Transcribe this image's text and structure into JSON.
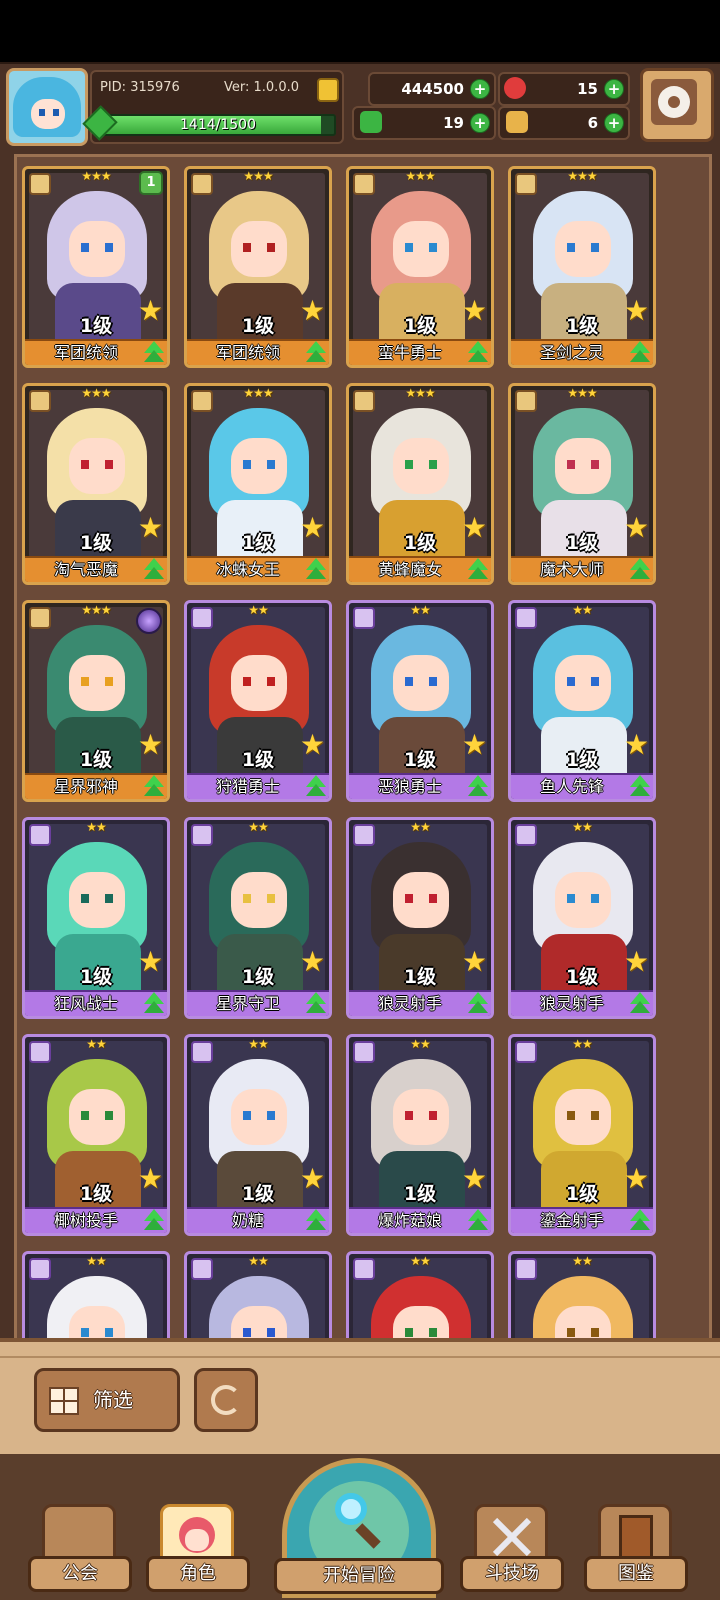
{
  "header": {
    "pid": "PID: 315976",
    "version": "Ver: 1.0.0.0",
    "exp_text": "1414/1500",
    "exp_progress": 0.943,
    "resources": [
      {
        "name": "gold",
        "value": "444500",
        "color": "#f0c234"
      },
      {
        "name": "ruby",
        "value": "15",
        "color": "#e03c3c"
      },
      {
        "name": "clover",
        "value": "19",
        "color": "#3cb543"
      },
      {
        "name": "key",
        "value": "6",
        "color": "#e8b34a"
      }
    ]
  },
  "cards": [
    {
      "name": "军团统领",
      "level": "1级",
      "stars": "★★★",
      "style": "gold",
      "badge": "1",
      "hair": "#cfc6e8",
      "body": "#5a4a8a",
      "eye": "#2a6fd0"
    },
    {
      "name": "军团统领",
      "level": "1级",
      "stars": "★★★",
      "style": "gold",
      "hair": "#e8c888",
      "body": "#5a3a2a",
      "eye": "#b02020"
    },
    {
      "name": "蛮牛勇士",
      "level": "1级",
      "stars": "★★★",
      "style": "gold",
      "hair": "#e89a8a",
      "body": "#d8b060",
      "eye": "#2a8ad0"
    },
    {
      "name": "圣剑之灵",
      "level": "1级",
      "stars": "★★★",
      "style": "gold",
      "hair": "#d8e4f4",
      "body": "#c8b080",
      "eye": "#2a7ad0"
    },
    {
      "name": "淘气恶魔",
      "level": "1级",
      "stars": "★★★",
      "style": "gold",
      "hair": "#f4e0a8",
      "body": "#3a3a4a",
      "eye": "#c02030"
    },
    {
      "name": "冰蛛女王",
      "level": "1级",
      "stars": "★★★",
      "style": "gold",
      "hair": "#5ac8e8",
      "body": "#e8f0f8",
      "eye": "#2a7ad0"
    },
    {
      "name": "黄蜂魔女",
      "level": "1级",
      "stars": "★★★",
      "style": "gold",
      "hair": "#e8e4dc",
      "body": "#d8a030",
      "eye": "#2aa04a"
    },
    {
      "name": "魔术大师",
      "level": "1级",
      "stars": "★★★",
      "style": "gold",
      "hair": "#6ab8a0",
      "body": "#e8e0e8",
      "eye": "#c03050"
    },
    {
      "name": "星界邪神",
      "level": "1级",
      "stars": "★★★",
      "style": "gold",
      "orb": true,
      "hair": "#3a8a70",
      "body": "#2a5a48",
      "eye": "#e8a020"
    },
    {
      "name": "狩猎勇士",
      "level": "1级",
      "stars": "★★",
      "style": "purple",
      "hair": "#c83a2a",
      "body": "#3a3a3a",
      "eye": "#c02020"
    },
    {
      "name": "恶狼勇士",
      "level": "1级",
      "stars": "★★",
      "style": "purple",
      "hair": "#6ab8e0",
      "body": "#6a4a3a",
      "eye": "#2a6ad0"
    },
    {
      "name": "鱼人先锋",
      "level": "1级",
      "stars": "★★",
      "style": "purple",
      "hair": "#5ac0e0",
      "body": "#e8eef4",
      "eye": "#2a6ad0"
    },
    {
      "name": "狂风战士",
      "level": "1级",
      "stars": "★★",
      "style": "purple",
      "hair": "#5ad8b8",
      "body": "#3aa890",
      "eye": "#1a6a5a"
    },
    {
      "name": "星界守卫",
      "level": "1级",
      "stars": "★★",
      "style": "purple",
      "hair": "#2a6a5a",
      "body": "#3a5a4a",
      "eye": "#e8c040"
    },
    {
      "name": "狼灵射手",
      "level": "1级",
      "stars": "★★",
      "style": "purple",
      "hair": "#3a3030",
      "body": "#4a3a2a",
      "eye": "#c02030"
    },
    {
      "name": "狼灵射手",
      "level": "1级",
      "stars": "★★",
      "style": "purple",
      "hair": "#e8e8f0",
      "body": "#b02a2a",
      "eye": "#2a8ad0"
    },
    {
      "name": "椰树投手",
      "level": "1级",
      "stars": "★★",
      "style": "purple",
      "hair": "#a8c848",
      "body": "#a06030",
      "eye": "#2a8a3a"
    },
    {
      "name": "奶糖",
      "level": "1级",
      "stars": "★★",
      "style": "purple",
      "hair": "#e8eaf4",
      "body": "#5a4a3a",
      "eye": "#2a7ad0"
    },
    {
      "name": "爆炸菇娘",
      "level": "1级",
      "stars": "★★",
      "style": "purple",
      "hair": "#d8d0cc",
      "body": "#2a4a4a",
      "eye": "#c02030"
    },
    {
      "name": "鎏金射手",
      "level": "1级",
      "stars": "★★",
      "style": "purple",
      "hair": "#e0c040",
      "body": "#d0a830",
      "eye": "#8a5a10"
    },
    {
      "name": "",
      "level": "",
      "stars": "★★",
      "style": "purple",
      "partial": true,
      "hair": "#f0f0f4",
      "body": "#c8c8d8",
      "eye": "#2a8ad0"
    },
    {
      "name": "",
      "level": "",
      "stars": "★★",
      "style": "purple",
      "partial": true,
      "hair": "#b8b8e0",
      "body": "#6a6a9a",
      "eye": "#2a5ad0"
    },
    {
      "name": "",
      "level": "",
      "stars": "★★",
      "style": "purple",
      "partial": true,
      "hair": "#d03030",
      "body": "#4a2a3a",
      "eye": "#2a8a3a"
    },
    {
      "name": "",
      "level": "",
      "stars": "★★",
      "style": "purple",
      "partial": true,
      "hair": "#f0b860",
      "body": "#d09040",
      "eye": "#8a5a10"
    }
  ],
  "filter": {
    "label": "筛选"
  },
  "nav": {
    "guild": "公会",
    "character": "角色",
    "adventure": "开始冒险",
    "arena": "斗技场",
    "codex": "图鉴"
  }
}
